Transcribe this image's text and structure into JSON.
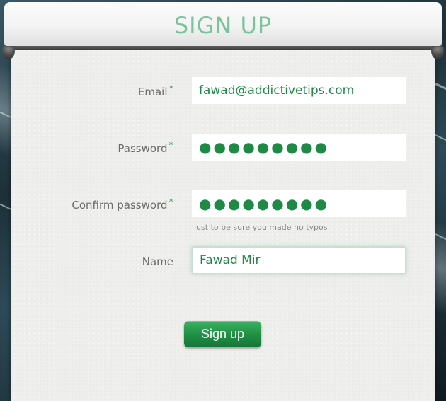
{
  "header": {
    "title": "SIGN UP"
  },
  "form": {
    "email": {
      "label": "Email",
      "required_mark": "*",
      "value": "fawad@addictivetips.com"
    },
    "password": {
      "label": "Password",
      "required_mark": "*",
      "value": "●●●●●●●●●"
    },
    "confirm_password": {
      "label": "Confirm password",
      "required_mark": "*",
      "value": "●●●●●●●●●",
      "hint": "just to be sure you made no typos"
    },
    "name": {
      "label": "Name",
      "value": "Fawad Mir"
    },
    "submit_label": "Sign up"
  },
  "colors": {
    "accent": "#1e8a45",
    "title": "#7cc29c",
    "button": "#1f8e43",
    "panel": "#eeeeec"
  }
}
